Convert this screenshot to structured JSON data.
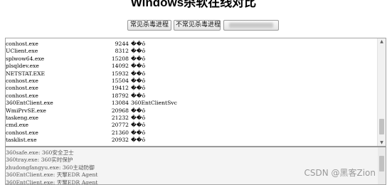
{
  "page": {
    "title": "Windows杀软在线对比"
  },
  "toolbar": {
    "common_label": "常见杀毒进程",
    "uncommon_label": "不常见杀毒进程",
    "third_label": ""
  },
  "process_table": {
    "rows": [
      {
        "name": "conhost.exe",
        "pid": "9244",
        "desc": "��ô"
      },
      {
        "name": "UClient.exe",
        "pid": "8312",
        "desc": "��ô"
      },
      {
        "name": "splwow64.exe",
        "pid": "15208",
        "desc": "��ô"
      },
      {
        "name": "plsqldev.exe",
        "pid": "14092",
        "desc": "��ô"
      },
      {
        "name": "NETSTAT.EXE",
        "pid": "15932",
        "desc": "��ô"
      },
      {
        "name": "conhost.exe",
        "pid": "15504",
        "desc": "��ô"
      },
      {
        "name": "conhost.exe",
        "pid": "19412",
        "desc": "��ô"
      },
      {
        "name": "conhost.exe",
        "pid": "18792",
        "desc": "��ô"
      },
      {
        "name": "360EntClient.exe",
        "pid": "13084",
        "desc": "360EntClientSvc"
      },
      {
        "name": "WmiPrvSE.exe",
        "pid": "20968",
        "desc": "��ô"
      },
      {
        "name": "taskeng.exe",
        "pid": "21232",
        "desc": "��ô"
      },
      {
        "name": "cmd.exe",
        "pid": "20772",
        "desc": "��ô"
      },
      {
        "name": "conhost.exe",
        "pid": "21360",
        "desc": "��ô"
      },
      {
        "name": "tasklist.exe",
        "pid": "20932",
        "desc": "��ô"
      }
    ]
  },
  "results": {
    "lines": [
      "360safe.exe: 360安全卫士",
      "360tray.exe: 360实时保护",
      "zhudongfangyu.exe: 360主动防御",
      "360EntClient.exe: 天擎EDR Agent",
      "360EntClient.exe: 天擎EDR Agent"
    ]
  },
  "watermark": "CSDN @黑客Zion",
  "icons": {
    "scroll_up": "chevron-up-icon",
    "scroll_down": "chevron-down-icon"
  }
}
